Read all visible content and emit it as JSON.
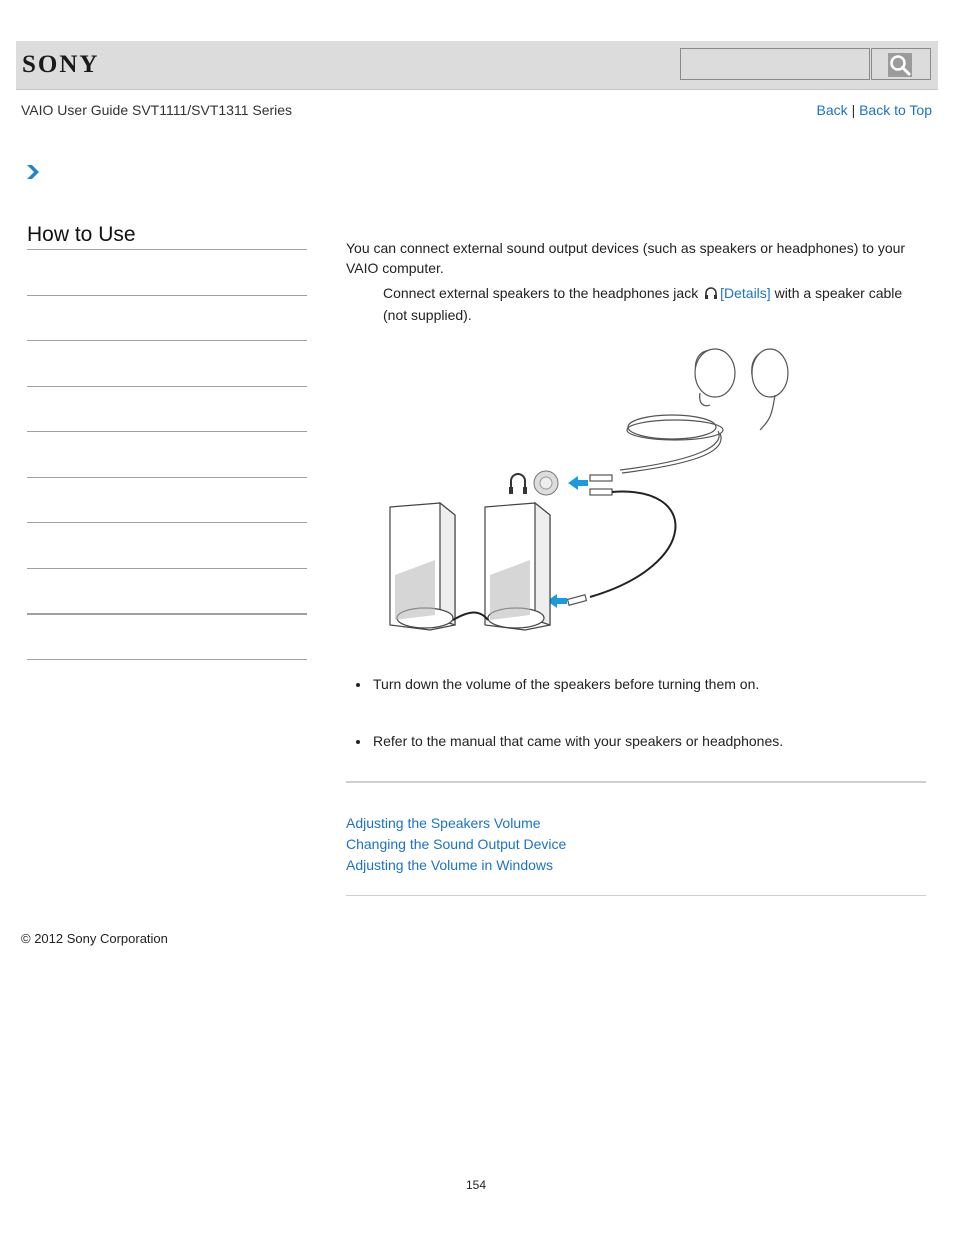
{
  "header": {
    "logo": "SONY",
    "search": {
      "placeholder": "",
      "value": "",
      "button_icon": "search-icon"
    }
  },
  "subheader": {
    "guide_title": "VAIO User Guide SVT1111/SVT1311 Series",
    "links": {
      "back": "Back",
      "separator": "|",
      "back_to_top": "Back to Top"
    }
  },
  "breadcrumb": {
    "icon": "chevron-right-icon"
  },
  "sidebar": {
    "title": "How to Use",
    "items": [
      "",
      "",
      "",
      "",
      "",
      "",
      "",
      "",
      ""
    ]
  },
  "main": {
    "intro": "You can connect external sound output devices (such as speakers or headphones) to your VAIO computer.",
    "step": {
      "text_before": "Connect external speakers to the headphones jack",
      "icon": "headphones-icon",
      "details_link": "[Details]",
      "text_after": "with a speaker cable (not supplied)."
    },
    "illustration": {
      "description": "Headphones and external speakers connecting to the headphones jack",
      "accent_color": "#1a9be0"
    },
    "notes": [
      "Turn down the volume of the speakers before turning them on.",
      "Refer to the manual that came with your speakers or headphones."
    ],
    "related_links": [
      "Adjusting the Speakers Volume",
      "Changing the Sound Output Device",
      "Adjusting the Volume in Windows"
    ]
  },
  "footer": {
    "copyright": "© 2012 Sony Corporation",
    "page_number": "154"
  },
  "colors": {
    "link": "#1a73c9",
    "header_bg": "#dcdcdc",
    "rule": "#a0a0a0"
  }
}
